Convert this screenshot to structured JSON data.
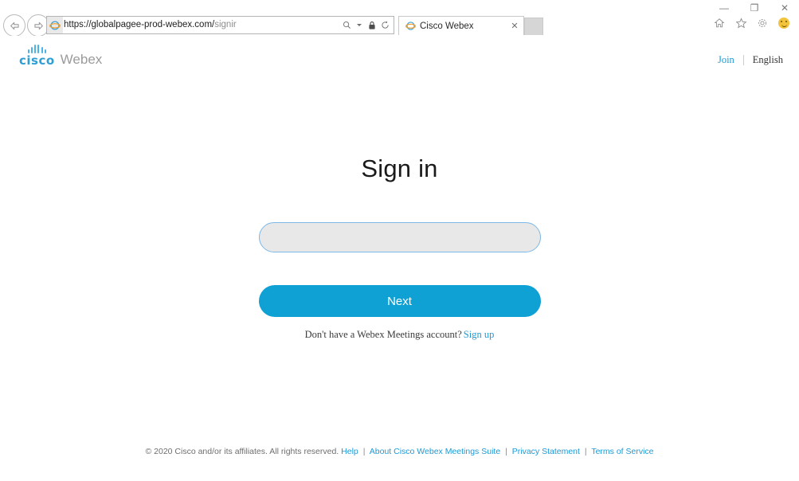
{
  "browser": {
    "window_controls": {
      "minimize": "—",
      "restore": "❐",
      "close": "✕"
    },
    "toolbar_icons": [
      {
        "name": "home-icon",
        "glyph": "⌂"
      },
      {
        "name": "favorites-star-icon",
        "glyph": "☆"
      },
      {
        "name": "tools-gear-icon",
        "glyph": "⚙"
      },
      {
        "name": "feedback-smiley-icon",
        "glyph": ""
      }
    ],
    "back_label": "←",
    "forward_label": "→",
    "address": {
      "url_main": "https://globalpagee-prod-webex.com/",
      "url_path": "signir",
      "search_icon": "⌕",
      "lock_icon": "🔒",
      "refresh_icon": "↻"
    },
    "tab": {
      "title": "Cisco Webex",
      "close": "✕"
    }
  },
  "header": {
    "logo_cisco": "cisco",
    "logo_webex": "Webex",
    "join_label": "Join",
    "language_label": "English"
  },
  "main": {
    "title": "Sign in",
    "email_value": "",
    "email_placeholder": "",
    "next_label": "Next",
    "signup_prompt": "Don't have a Webex Meetings account?",
    "signup_link": "Sign up"
  },
  "footer": {
    "copyright": "© 2020 Cisco and/or its affiliates. All rights reserved.",
    "links": [
      "Help",
      "About Cisco Webex Meetings Suite",
      "Privacy Statement",
      "Terms of Service"
    ],
    "separator": "|"
  },
  "colors": {
    "accent_blue": "#0fa0d4",
    "link_blue": "#1c9ad6",
    "input_fill": "#e8e8e8",
    "input_border": "#7cb8e8",
    "logo_blue": "#2e9fd4"
  }
}
